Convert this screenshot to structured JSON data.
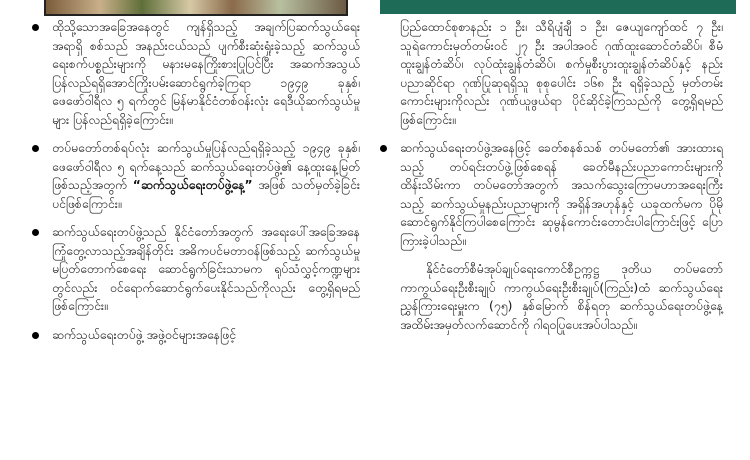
{
  "left_column": [
    {
      "type": "bullet",
      "text": "ထိုသို့သောအခြေအနေတွင် ကျန်ရှိသည့် အချက်ပြဆက်သွယ်ရေးအရာရှိ စစ်သည် အနည်းငယ်သည် ပျက်စီးဆုံးရှုံးခဲ့သည့် ဆက်သွယ်ရေးစက်ပစ္စည်းများကို မနားမနေကြိုးစားပြုပြင်ပြီး အဆက်အသွယ်ပြန်လည်ရရှိအောင်ကြိုးပမ်းဆောင်ရွက်ခဲ့ကြရာ ၁၉၄၉ ခုနှစ်၊ ဖေဖော်ဝါရီလ ၅ ရက်တွင် မြန်မာနိုင်ငံတစ်ဝန်းလုံး ရေဒီယိုဆက်သွယ်မှုများ ပြန်လည်ရရှိခဲ့ကြောင်း။"
    },
    {
      "type": "bullet",
      "text_before": "တပ်မတော်တစ်ရပ်လုံး ဆက်သွယ်မှုပြန်လည်ရရှိခဲ့သည့် ၁၉၄၉ ခုနှစ်၊ ဖေဖော်ဝါရီလ ၅ ရက်နေ့သည် ဆက်သွယ်ရေးတပ်ဖွဲ့၏ နေ့ထူးနေ့မြတ်ဖြစ်သည့်အတွက် ",
      "bold": "“ဆက်သွယ်ရေးတပ်ဖွဲ့နေ့”",
      "text_after": " အဖြစ် သတ်မှတ်ခဲ့ခြင်းပင်ဖြစ်ကြောင်း။"
    },
    {
      "type": "bullet",
      "text": "ဆက်သွယ်ရေးတပ်ဖွဲ့သည် နိုင်ငံတော်အတွက် အရေးပေါ်အခြေအနေ ကြုံတွေ့လာသည့်အချိန်တိုင်း အဓိကပင်မတာဝန်ဖြစ်သည့် ဆက်သွယ်မှုမပြတ်တောက်စေရေး ဆောင်ရွက်ခြင်းသာမက ရုပ်သံလွှင့်ကဏ္ဍများတွင်လည်း ဝင်ရောက်ဆောင်ရွက်ပေးနိုင်သည်ကိုလည်း တွေ့ရှိရမည်ဖြစ်ကြောင်း။"
    },
    {
      "type": "bullet",
      "text": "ဆက်သွယ်ရေးတပ်ဖွဲ့ အဖွဲ့ဝင်များအနေဖြင့်"
    }
  ],
  "right_column": [
    {
      "type": "plain",
      "text": "ပြည်ထောင်စုစာနည်း ၁ ဦး၊ သီရိပျံချီ ၁ ဦး၊ ဇေယျကျော်ထင် ၇ ဦး၊ သူရဲကောင်းမှတ်တမ်းဝင် ၂၇ ဦး အပါအဝင် ဂုဏ်ထူးဆောင်တံဆိပ်၊ စီမံထူးချွန်တံဆိပ်၊ လုပ်ထုံးချွန်တံဆိပ်၊ စက်မှုစီးပွားထူးချွန်တံဆိပ်နှင့် နည်းပညာဆိုင်ရာ ဂုဏ်ပြုဆုရရှိသူ စုစုပေါင်း ၁၆၈ ဦး ရရှိခဲ့သည့် မှတ်တမ်းကောင်းများကိုလည်း ဂုဏ်ယူဖွယ်ရာ ပိုင်ဆိုင်ခဲ့ကြသည်ကို တွေ့ရှိရမည်ဖြစ်ကြောင်း။"
    },
    {
      "type": "bullet",
      "text": "ဆက်သွယ်ရေးတပ်ဖွဲ့အနေဖြင့် ခေတ်စနစ်သစ် တပ်မတော်၏ အားထားရသည့် တပ်ရင်းတပ်ဖွဲ့ဖြစ်စေရန် ခေတ်မီနည်းပညာကောင်းများကို ထိန်းသိမ်းကာ တပ်မတော်အတွက် အသက်သွေးကြောမဟာအရေးကြီးသည့် ဆက်သွယ်မှုနည်းပညာများကို အရှိန်အဟုန်နှင့် ယခုထက်မက ပိုမိုဆောင်ရွက်နိုင်ကြပါစေကြောင်း ဆုမွန်ကောင်းတောင်းပါကြောင်းဖြင့် ပြောကြားခဲ့ပါသည်။"
    },
    {
      "type": "indent",
      "text": "နိုင်ငံတော်စီမံအုပ်ချုပ်ရေးကောင်စီဥက္ကဋ္ဌ ဒုတိယ တပ်မတော်ကာကွယ်ရေးဦးစီးချုပ် ကာကွယ်ရေးဦးစီးချုပ်(ကြည်း)ထံ ဆက်သွယ်ရေးညွှန်ကြားရေးမှူးက (၇၅) နှစ်မြောက် စိန်ရတု ဆက်သွယ်ရေးတပ်ဖွဲ့နေ့ အထိမ်းအမှတ်လက်ဆောင်ကို ဂါရဝပြုပေးအပ်ပါသည်။"
    }
  ]
}
